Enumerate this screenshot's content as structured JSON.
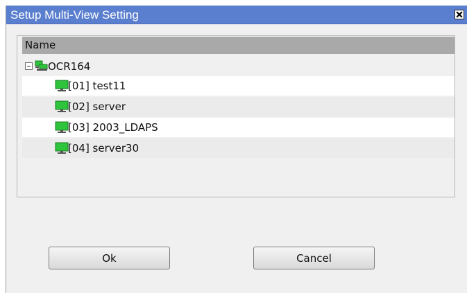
{
  "window": {
    "title": "Setup Multi-View Setting",
    "title_bar_color": "#5b7fcf"
  },
  "tree": {
    "column_header": "Name",
    "root": {
      "label": "OCR164",
      "icon": "network-computer-icon",
      "expanded": true
    },
    "children": [
      {
        "label": "[01] test11",
        "icon": "monitor-icon"
      },
      {
        "label": "[02] server",
        "icon": "monitor-icon"
      },
      {
        "label": "[03] 2003_LDAPS",
        "icon": "monitor-icon"
      },
      {
        "label": "[04] server30",
        "icon": "monitor-icon"
      }
    ]
  },
  "buttons": {
    "ok_label": "Ok",
    "cancel_label": "Cancel"
  },
  "colors": {
    "header_bg": "#a9a9a9",
    "monitor_green": "#2ec43c"
  }
}
